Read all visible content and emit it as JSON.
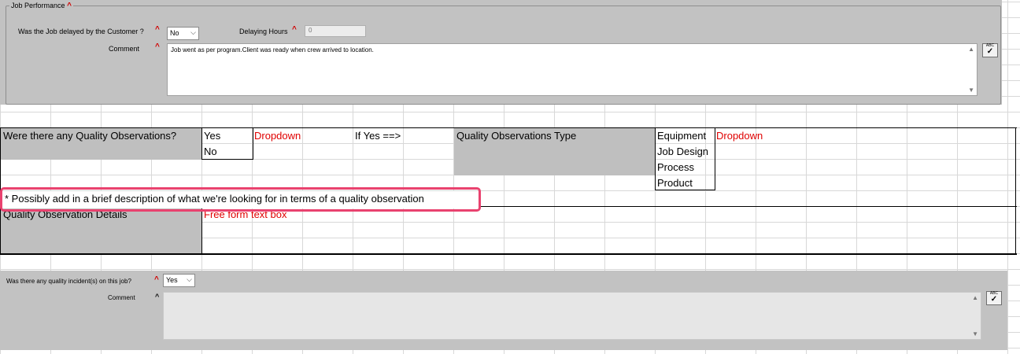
{
  "job_performance": {
    "title": "Job Performance",
    "required_mark": "^",
    "delayed_label": "Was the Job delayed by the Customer ?",
    "delayed_value": "No",
    "delaying_hours_label": "Delaying Hours",
    "delaying_hours_value": "0",
    "comment_label": "Comment",
    "comment_value": "Job went as per program.Client was ready when crew arrived to location.",
    "spell_label": "ABC"
  },
  "sheet": {
    "q_question": "Were there any Quality Observations?",
    "yes": "Yes",
    "no": "No",
    "dropdown_note_1": "Dropdown",
    "if_yes": "If Yes ==>",
    "type_label": "Quality Observations Type",
    "types": [
      "Equipment",
      "Job Design",
      "Process",
      "Product"
    ],
    "dropdown_note_2": "Dropdown",
    "annotation": "* Possibly add in a brief description of what we're looking for in terms of a quality observation",
    "details_label": "Quality Observation Details",
    "details_note": "Free form text box"
  },
  "incident": {
    "question": "Was there any quality incident(s) on this job?",
    "required_mark": "^",
    "value": "Yes",
    "comment_label": "Comment",
    "comment_mark": "^",
    "comment_value": "",
    "spell_label": "ABC"
  },
  "colors": {
    "panel_grey": "#c2c2c2",
    "required_red": "#d00000",
    "note_red": "#e00000",
    "highlight_pink": "#e9426f"
  }
}
